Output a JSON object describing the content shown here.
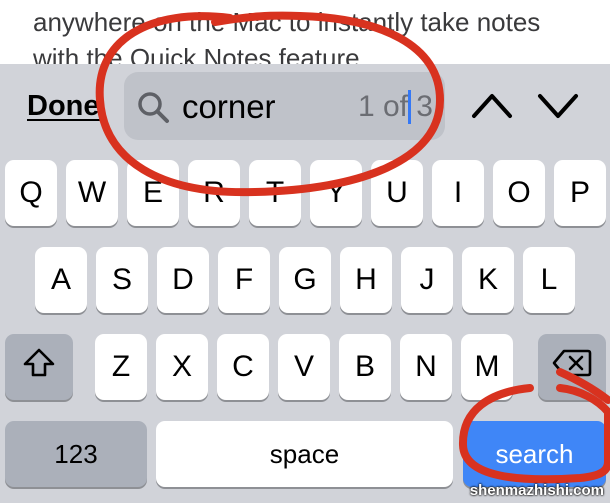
{
  "document": {
    "text": "anywhere on the Mac to instantly take notes with the Quick Notes feature."
  },
  "find_bar": {
    "done_label": "Done",
    "query": "corner",
    "match_count": "1 of 3",
    "icons": {
      "search": "magnifier-icon",
      "previous": "chevron-up-icon",
      "next": "chevron-down-icon"
    }
  },
  "keyboard": {
    "row1": [
      "Q",
      "W",
      "E",
      "R",
      "T",
      "Y",
      "U",
      "I",
      "O",
      "P"
    ],
    "row2": [
      "A",
      "S",
      "D",
      "F",
      "G",
      "H",
      "J",
      "K",
      "L"
    ],
    "row3": [
      "Z",
      "X",
      "C",
      "V",
      "B",
      "N",
      "M"
    ],
    "numbers_label": "123",
    "space_label": "space",
    "search_label": "search",
    "icons": {
      "shift": "shift-arrow-icon",
      "delete": "backspace-icon"
    }
  },
  "colors": {
    "keyboard_bg": "#d1d3d9",
    "key_bg": "#ffffff",
    "dark_key_bg": "#abb0ba",
    "search_key_bg": "#3f86f7",
    "annotation": "#d8321f"
  },
  "watermark": "shenmazhishi.com"
}
